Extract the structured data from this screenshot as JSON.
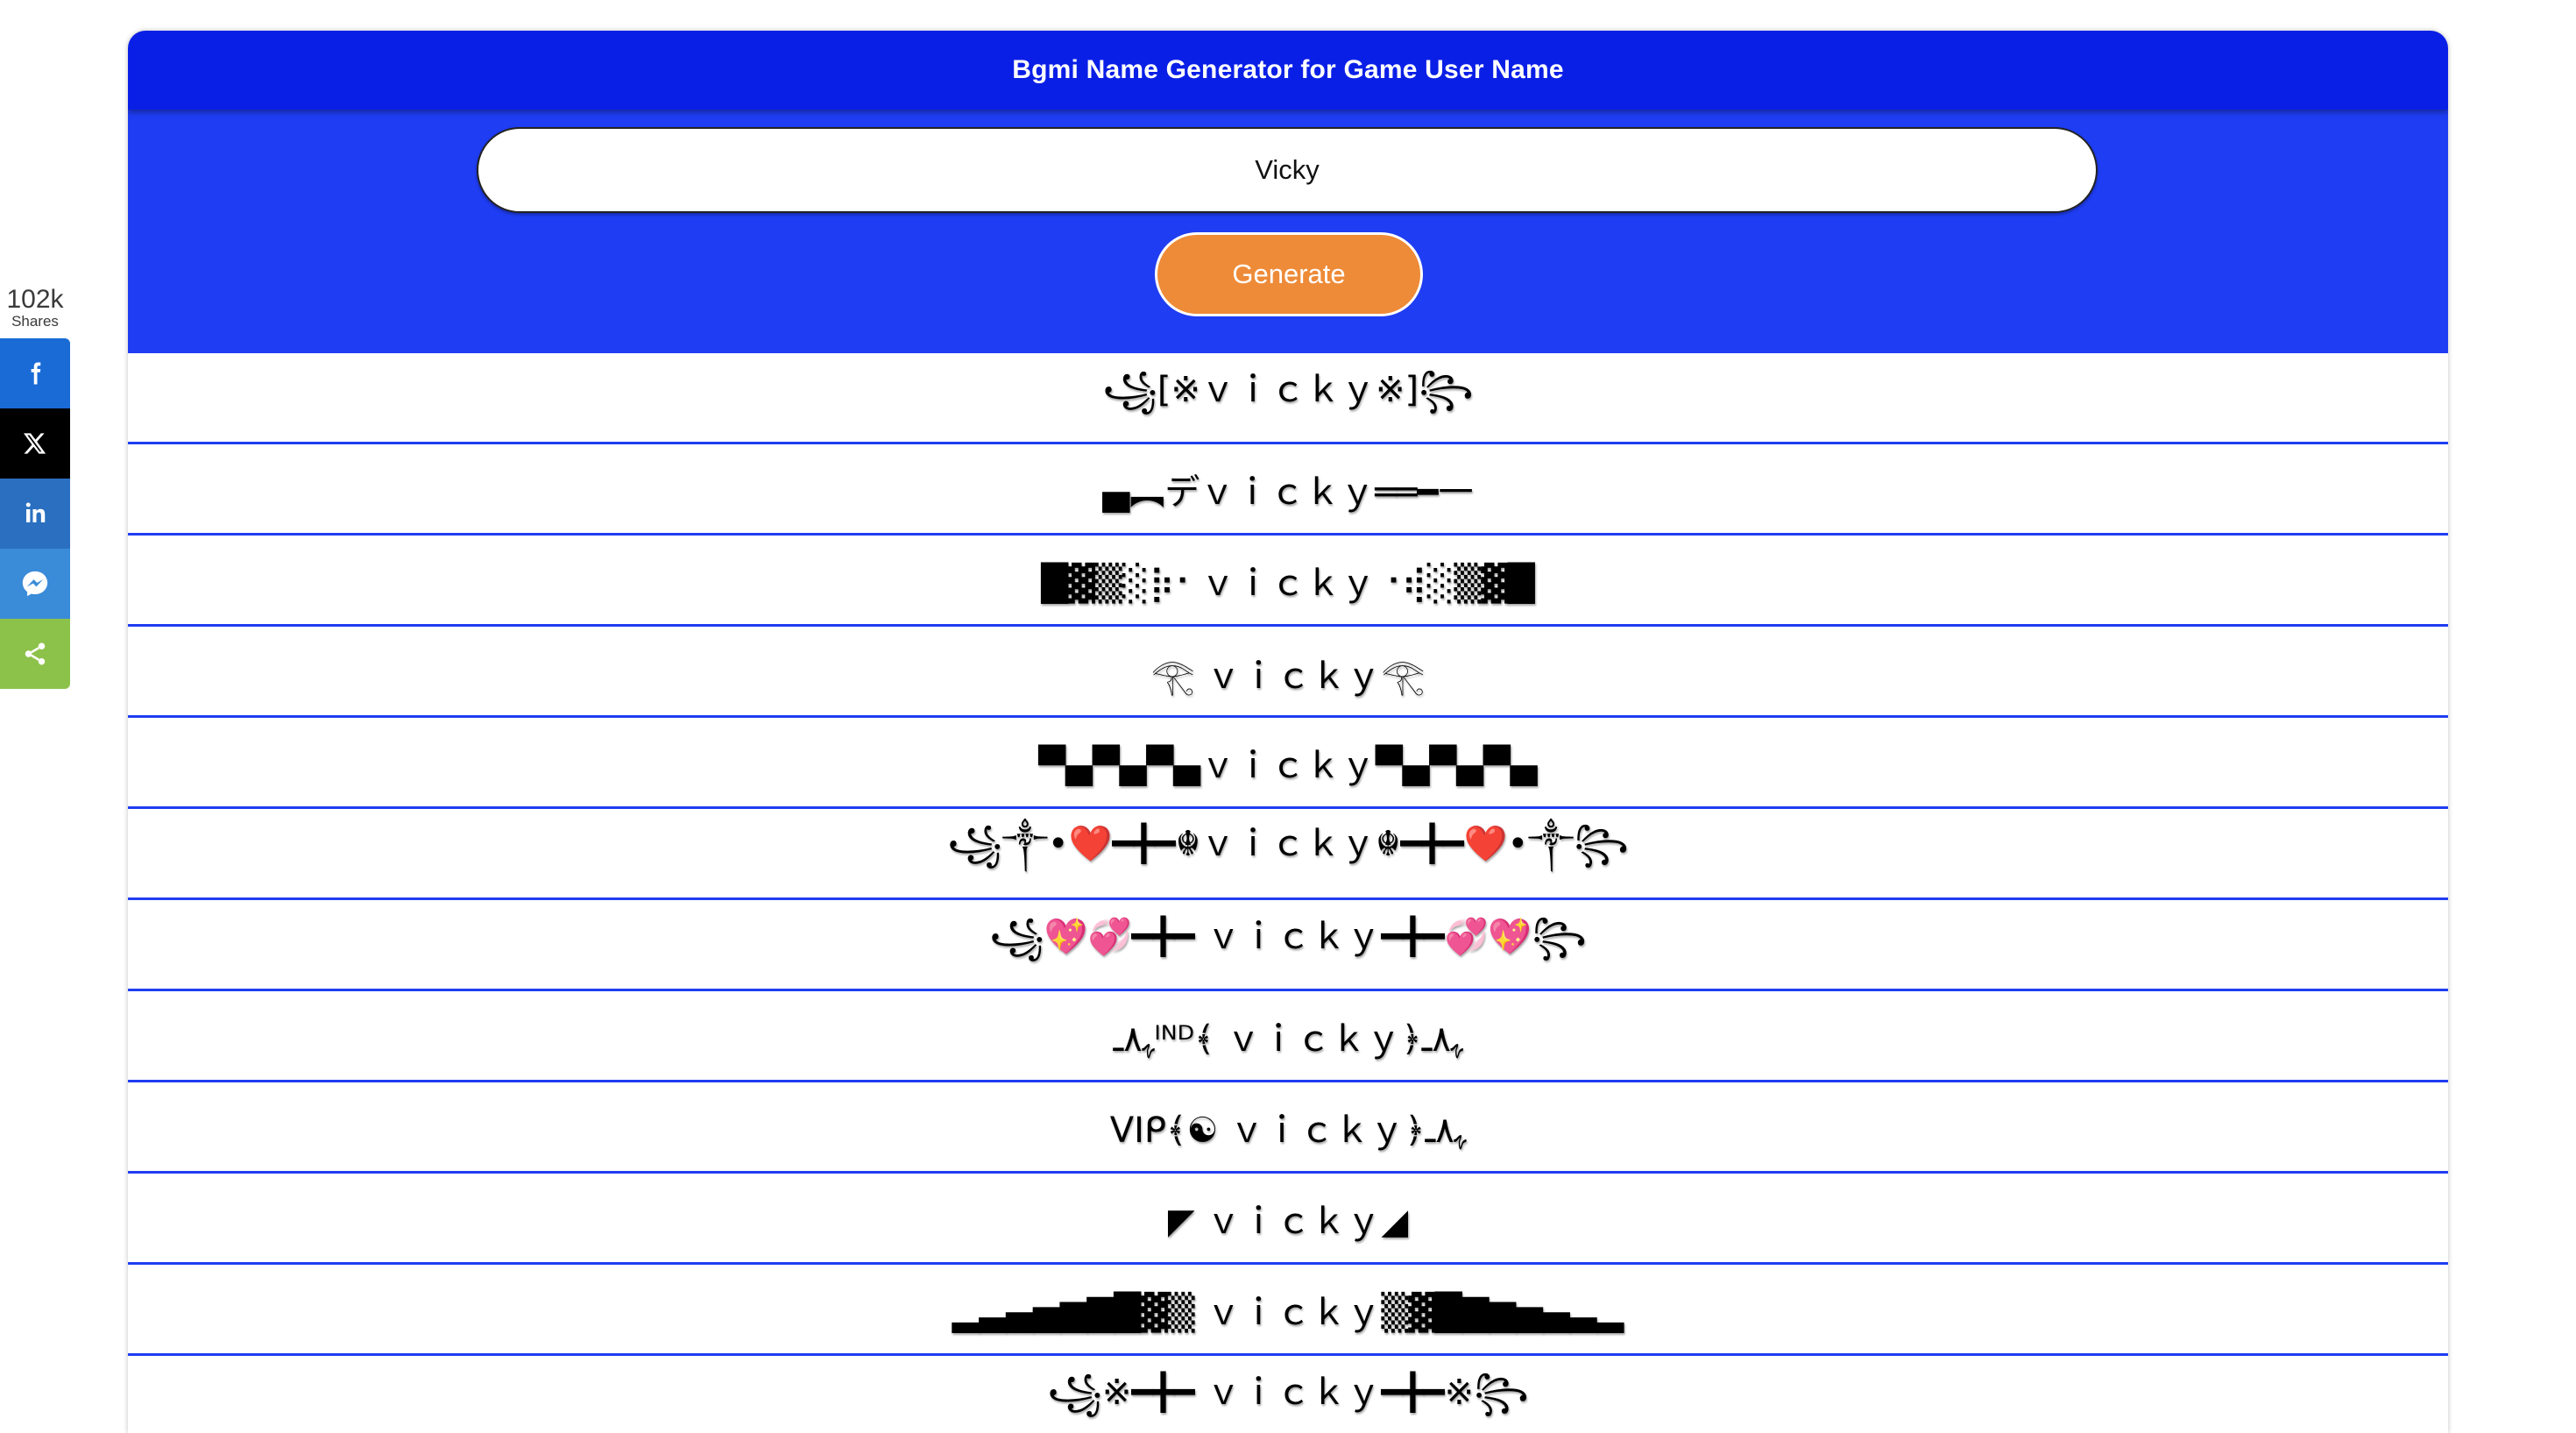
{
  "share": {
    "count": "102k",
    "count_label": "Shares",
    "buttons": [
      {
        "network": "facebook",
        "icon": "facebook-icon"
      },
      {
        "network": "x",
        "icon": "x-icon"
      },
      {
        "network": "linkedin",
        "icon": "linkedin-icon"
      },
      {
        "network": "messenger",
        "icon": "messenger-icon"
      },
      {
        "network": "sharethis",
        "icon": "share-icon"
      }
    ]
  },
  "header": {
    "title": "Bgmi Name Generator for Game User Name"
  },
  "form": {
    "input_value": "Vicky",
    "generate_label": "Generate"
  },
  "colors": {
    "header_blue": "#0a1fe6",
    "form_blue": "#1f3df2",
    "button_orange": "#ee8b38",
    "divider_blue": "#1f3df2"
  },
  "results": [
    "꧁[※ｖｉｃｋｙ※]꧂",
    "▄︻デｖｉｃｋｙ══━一",
    "█▓▒░⡷⠂ｖｉｃｋｙ⠐⢾░▒▓█",
    "𓂀 ｖｉｃｋｙ𓂀",
    "▀▄▀▄▀▄ｖｉｃｋｙ▀▄▀▄▀▄",
    "꧁༒•❤️━╋━☬ｖｉｃｋｙ☬━╋━❤️•༒꧂",
    "꧁💖💞━╋━ ｖｉｃｋｙ━╋━💞💖꧂",
    "ﮩ٨ـᴵᴺᴰ﴾ ｖｉｃｋｙ﴿ﮩ٨ـ",
    "ᐯIᑭ﴾☯ ｖｉｃｋｙ﴿ﮩ٨ـ",
    "◤ ｖｉｃｋｙ◢",
    "▂▃▄▅▆▇█▓▒ ｖｉｃｋｙ▒▓█▇▆▅▄▃▂",
    "꧁※━╋━ ｖｉｃｋｙ━╋━※꧂"
  ]
}
